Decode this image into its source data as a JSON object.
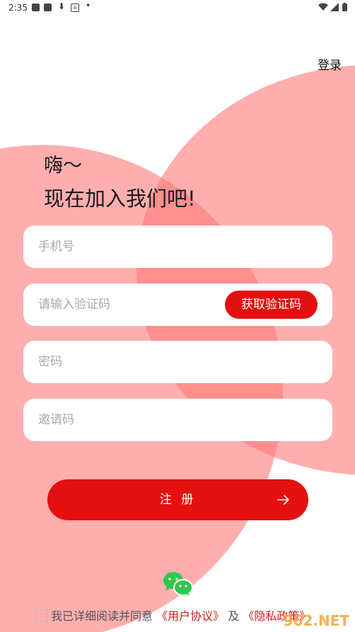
{
  "status_bar": {
    "time": "2:35"
  },
  "header": {
    "login_label": "登录"
  },
  "hero": {
    "greeting": "嗨～",
    "headline": "现在加入我们吧!"
  },
  "form": {
    "phone_placeholder": "手机号",
    "code_placeholder": "请输入验证码",
    "get_code_label": "获取验证码",
    "password_placeholder": "密码",
    "invite_placeholder": "邀请码"
  },
  "register": {
    "label": "注 册"
  },
  "agreement": {
    "prefix": "我已详细阅读并同意",
    "user_agreement": "《用户协议》",
    "and": "及",
    "privacy_policy": "《隐私政策》"
  },
  "watermark": "962.NET",
  "colors": {
    "accent": "#e51010",
    "blob": "#ff7d7d",
    "wechat": "#2dc84d"
  },
  "icons": {
    "wechat": "wechat-icon",
    "arrow": "arrow-right-icon"
  }
}
